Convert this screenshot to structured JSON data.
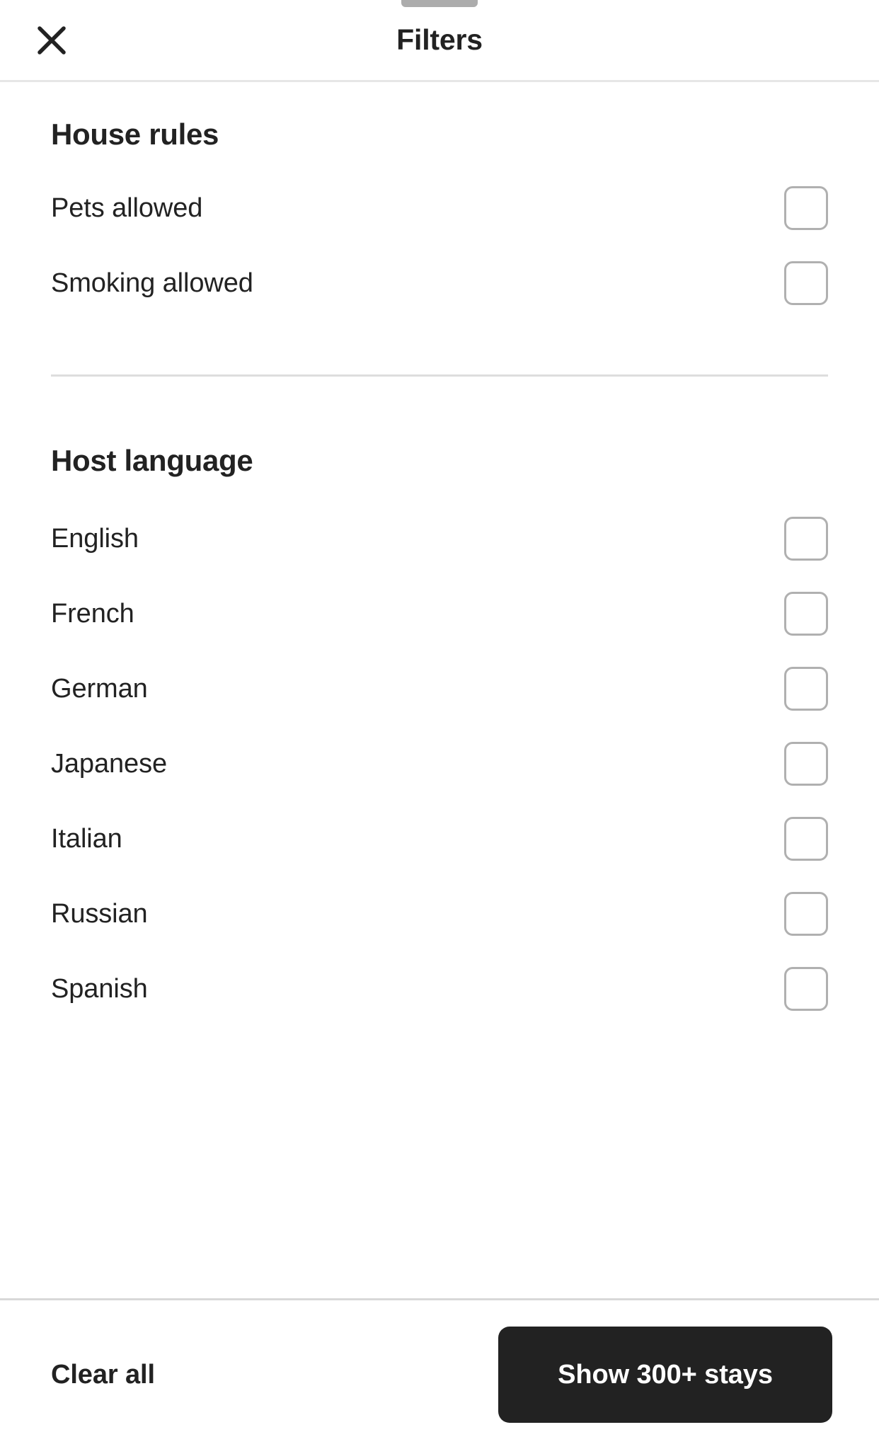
{
  "header": {
    "title": "Filters",
    "close_icon": "close-x-icon",
    "drag_handle": "sheet-drag-handle"
  },
  "sections": [
    {
      "id": "house-rules",
      "title": "House rules",
      "items": [
        {
          "label": "Pets allowed",
          "checked": false
        },
        {
          "label": "Smoking allowed",
          "checked": false
        }
      ]
    },
    {
      "id": "host-language",
      "title": "Host language",
      "items": [
        {
          "label": "English",
          "checked": false
        },
        {
          "label": "French",
          "checked": false
        },
        {
          "label": "German",
          "checked": false
        },
        {
          "label": "Japanese",
          "checked": false
        },
        {
          "label": "Italian",
          "checked": false
        },
        {
          "label": "Russian",
          "checked": false
        },
        {
          "label": "Spanish",
          "checked": false
        }
      ]
    }
  ],
  "footer": {
    "clear_label": "Clear all",
    "submit_label": "Show 300+ stays"
  },
  "colors": {
    "text": "#222222",
    "button_bg": "#222222",
    "button_text": "#ffffff",
    "checkbox_border": "#b0b0b0",
    "divider": "#dddddd",
    "handle": "#acacac"
  }
}
